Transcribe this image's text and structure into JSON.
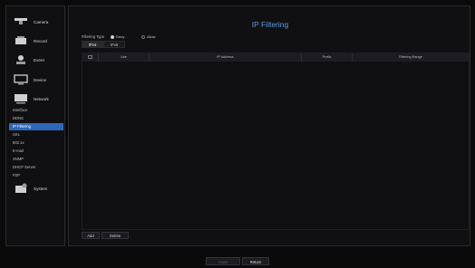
{
  "sidebar": {
    "groups": [
      {
        "label": "Camera",
        "icon": "camera-icon"
      },
      {
        "label": "Record",
        "icon": "record-icon"
      },
      {
        "label": "Event",
        "icon": "event-icon"
      },
      {
        "label": "Device",
        "icon": "device-icon"
      },
      {
        "label": "Network",
        "icon": "network-icon"
      },
      {
        "label": "System",
        "icon": "system-icon"
      }
    ],
    "network_items": [
      "Interface",
      "DDNS",
      "IP Filtering",
      "SSL",
      "802.1x",
      "E-mail",
      "SNMP",
      "DHCP Server",
      "P2P"
    ],
    "active_item": "IP Filtering"
  },
  "main": {
    "title": "IP Filtering",
    "filtering_type_label": "Filtering Type",
    "filter_options": [
      "Deny",
      "Allow"
    ],
    "selected_option": "Deny",
    "tabs": [
      "IPv4",
      "IPv6"
    ],
    "active_tab": "IPv4",
    "table_headers": [
      "Use",
      "IP Address",
      "Prefix",
      "Filtering Range"
    ],
    "add_label": "Add",
    "delete_label": "Delete"
  },
  "footer": {
    "apply_label": "Apply",
    "return_label": "Return"
  }
}
